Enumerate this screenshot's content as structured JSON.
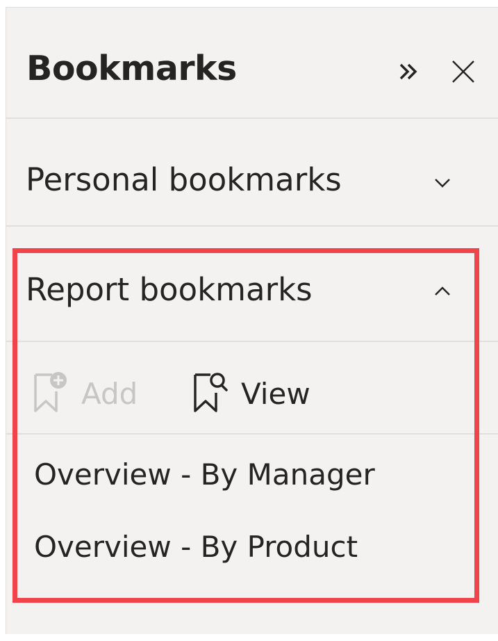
{
  "pane": {
    "title": "Bookmarks",
    "expand_icon": "double-chevron-right-icon",
    "close_icon": "close-icon"
  },
  "sections": [
    {
      "label": "Personal bookmarks",
      "expanded": false,
      "chevron_icon": "chevron-down-icon"
    },
    {
      "label": "Report bookmarks",
      "expanded": true,
      "chevron_icon": "chevron-up-icon"
    }
  ],
  "toolbar": {
    "add_label": "Add",
    "add_enabled": false,
    "add_icon": "bookmark-add-icon",
    "view_label": "View",
    "view_icon": "bookmark-view-icon"
  },
  "report_bookmarks": [
    "Overview - By Manager",
    "Overview - By Product"
  ],
  "colors": {
    "pane_bg": "#f3f2f1",
    "text": "#252423",
    "disabled_text": "#c8c6c4",
    "highlight_border": "#f0434a",
    "divider": "#e1dfdd"
  }
}
